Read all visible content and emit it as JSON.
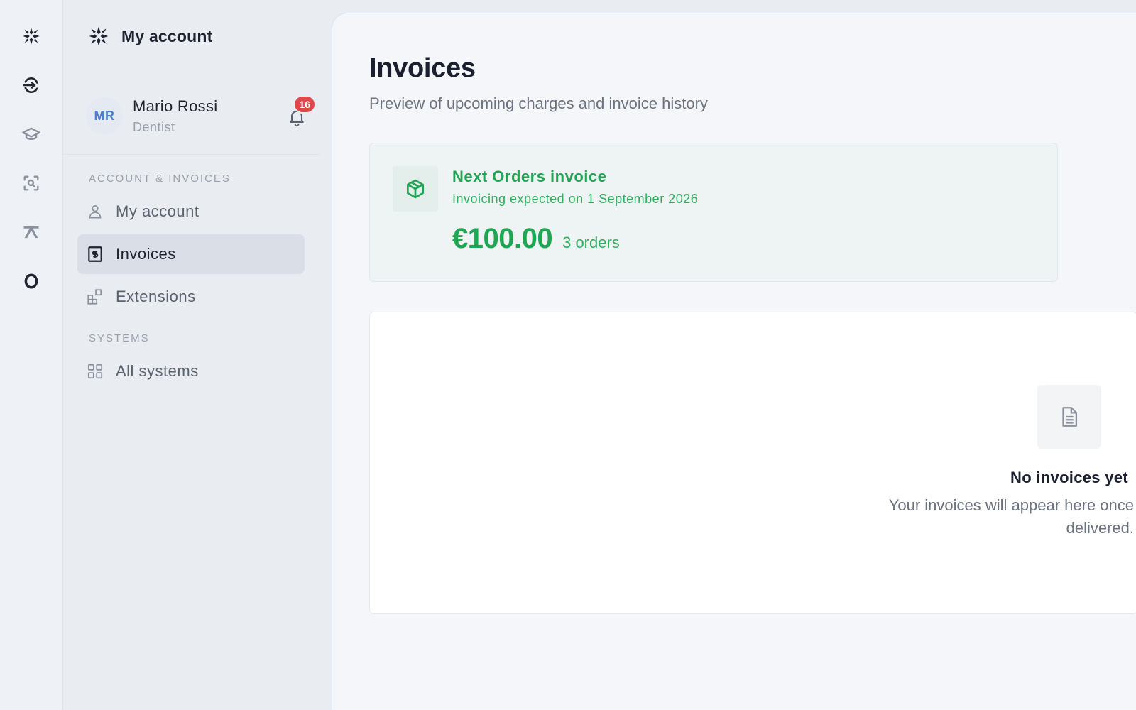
{
  "rail": {
    "items": [
      {
        "icon": "brand-logo-icon"
      },
      {
        "icon": "sync-arrows-icon"
      },
      {
        "icon": "graduation-cap-icon"
      },
      {
        "icon": "scan-search-icon"
      },
      {
        "icon": "fork-tool-icon"
      },
      {
        "icon": "ring-icon"
      }
    ]
  },
  "sidebar": {
    "brand_title": "My account",
    "profile": {
      "initials": "MR",
      "name": "Mario Rossi",
      "role": "Dentist",
      "notifications": "16"
    },
    "sections": [
      {
        "label": "ACCOUNT & INVOICES",
        "items": [
          {
            "label": "My account",
            "icon": "user-icon",
            "active": false
          },
          {
            "label": "Invoices",
            "icon": "invoice-icon",
            "active": true
          },
          {
            "label": "Extensions",
            "icon": "extensions-icon",
            "active": false
          }
        ]
      },
      {
        "label": "SYSTEMS",
        "items": [
          {
            "label": "All systems",
            "icon": "grid-icon",
            "active": false
          }
        ]
      }
    ]
  },
  "main": {
    "title": "Invoices",
    "subtitle": "Preview of upcoming charges and invoice history",
    "next_invoice": {
      "title": "Next Orders invoice",
      "expected": "Invoicing expected on 1 September 2026",
      "amount": "€100.00",
      "orders": "3 orders"
    },
    "history": {
      "empty_title": "No invoices yet",
      "empty_text": "Your invoices will appear here once delivered."
    }
  },
  "colors": {
    "accent_green": "#22a455",
    "badge_red": "#e2474b",
    "avatar_blue": "#4a7fd6"
  }
}
